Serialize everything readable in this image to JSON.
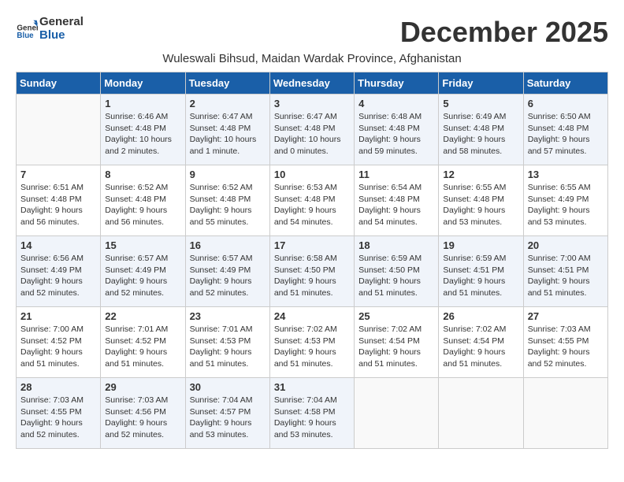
{
  "header": {
    "logo_general": "General",
    "logo_blue": "Blue",
    "month_title": "December 2025",
    "subtitle": "Wuleswali Bihsud, Maidan Wardak Province, Afghanistan"
  },
  "weekdays": [
    "Sunday",
    "Monday",
    "Tuesday",
    "Wednesday",
    "Thursday",
    "Friday",
    "Saturday"
  ],
  "weeks": [
    [
      {
        "day": "",
        "info": ""
      },
      {
        "day": "1",
        "info": "Sunrise: 6:46 AM\nSunset: 4:48 PM\nDaylight: 10 hours\nand 2 minutes."
      },
      {
        "day": "2",
        "info": "Sunrise: 6:47 AM\nSunset: 4:48 PM\nDaylight: 10 hours\nand 1 minute."
      },
      {
        "day": "3",
        "info": "Sunrise: 6:47 AM\nSunset: 4:48 PM\nDaylight: 10 hours\nand 0 minutes."
      },
      {
        "day": "4",
        "info": "Sunrise: 6:48 AM\nSunset: 4:48 PM\nDaylight: 9 hours\nand 59 minutes."
      },
      {
        "day": "5",
        "info": "Sunrise: 6:49 AM\nSunset: 4:48 PM\nDaylight: 9 hours\nand 58 minutes."
      },
      {
        "day": "6",
        "info": "Sunrise: 6:50 AM\nSunset: 4:48 PM\nDaylight: 9 hours\nand 57 minutes."
      }
    ],
    [
      {
        "day": "7",
        "info": "Sunrise: 6:51 AM\nSunset: 4:48 PM\nDaylight: 9 hours\nand 56 minutes."
      },
      {
        "day": "8",
        "info": "Sunrise: 6:52 AM\nSunset: 4:48 PM\nDaylight: 9 hours\nand 56 minutes."
      },
      {
        "day": "9",
        "info": "Sunrise: 6:52 AM\nSunset: 4:48 PM\nDaylight: 9 hours\nand 55 minutes."
      },
      {
        "day": "10",
        "info": "Sunrise: 6:53 AM\nSunset: 4:48 PM\nDaylight: 9 hours\nand 54 minutes."
      },
      {
        "day": "11",
        "info": "Sunrise: 6:54 AM\nSunset: 4:48 PM\nDaylight: 9 hours\nand 54 minutes."
      },
      {
        "day": "12",
        "info": "Sunrise: 6:55 AM\nSunset: 4:48 PM\nDaylight: 9 hours\nand 53 minutes."
      },
      {
        "day": "13",
        "info": "Sunrise: 6:55 AM\nSunset: 4:49 PM\nDaylight: 9 hours\nand 53 minutes."
      }
    ],
    [
      {
        "day": "14",
        "info": "Sunrise: 6:56 AM\nSunset: 4:49 PM\nDaylight: 9 hours\nand 52 minutes."
      },
      {
        "day": "15",
        "info": "Sunrise: 6:57 AM\nSunset: 4:49 PM\nDaylight: 9 hours\nand 52 minutes."
      },
      {
        "day": "16",
        "info": "Sunrise: 6:57 AM\nSunset: 4:49 PM\nDaylight: 9 hours\nand 52 minutes."
      },
      {
        "day": "17",
        "info": "Sunrise: 6:58 AM\nSunset: 4:50 PM\nDaylight: 9 hours\nand 51 minutes."
      },
      {
        "day": "18",
        "info": "Sunrise: 6:59 AM\nSunset: 4:50 PM\nDaylight: 9 hours\nand 51 minutes."
      },
      {
        "day": "19",
        "info": "Sunrise: 6:59 AM\nSunset: 4:51 PM\nDaylight: 9 hours\nand 51 minutes."
      },
      {
        "day": "20",
        "info": "Sunrise: 7:00 AM\nSunset: 4:51 PM\nDaylight: 9 hours\nand 51 minutes."
      }
    ],
    [
      {
        "day": "21",
        "info": "Sunrise: 7:00 AM\nSunset: 4:52 PM\nDaylight: 9 hours\nand 51 minutes."
      },
      {
        "day": "22",
        "info": "Sunrise: 7:01 AM\nSunset: 4:52 PM\nDaylight: 9 hours\nand 51 minutes."
      },
      {
        "day": "23",
        "info": "Sunrise: 7:01 AM\nSunset: 4:53 PM\nDaylight: 9 hours\nand 51 minutes."
      },
      {
        "day": "24",
        "info": "Sunrise: 7:02 AM\nSunset: 4:53 PM\nDaylight: 9 hours\nand 51 minutes."
      },
      {
        "day": "25",
        "info": "Sunrise: 7:02 AM\nSunset: 4:54 PM\nDaylight: 9 hours\nand 51 minutes."
      },
      {
        "day": "26",
        "info": "Sunrise: 7:02 AM\nSunset: 4:54 PM\nDaylight: 9 hours\nand 51 minutes."
      },
      {
        "day": "27",
        "info": "Sunrise: 7:03 AM\nSunset: 4:55 PM\nDaylight: 9 hours\nand 52 minutes."
      }
    ],
    [
      {
        "day": "28",
        "info": "Sunrise: 7:03 AM\nSunset: 4:55 PM\nDaylight: 9 hours\nand 52 minutes."
      },
      {
        "day": "29",
        "info": "Sunrise: 7:03 AM\nSunset: 4:56 PM\nDaylight: 9 hours\nand 52 minutes."
      },
      {
        "day": "30",
        "info": "Sunrise: 7:04 AM\nSunset: 4:57 PM\nDaylight: 9 hours\nand 53 minutes."
      },
      {
        "day": "31",
        "info": "Sunrise: 7:04 AM\nSunset: 4:58 PM\nDaylight: 9 hours\nand 53 minutes."
      },
      {
        "day": "",
        "info": ""
      },
      {
        "day": "",
        "info": ""
      },
      {
        "day": "",
        "info": ""
      }
    ]
  ]
}
